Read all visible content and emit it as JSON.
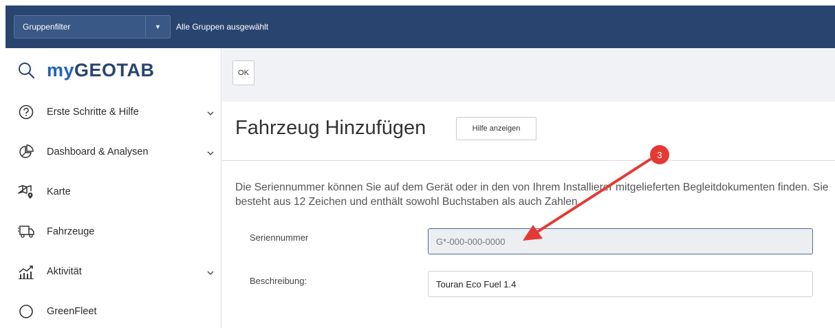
{
  "topbar": {
    "group_filter_label": "Gruppenfilter",
    "group_filter_summary": "Alle Gruppen ausgewählt"
  },
  "sidebar": {
    "logo_prefix": "my",
    "logo_main": "GEOTAB",
    "items": [
      {
        "label": "Erste Schritte & Hilfe",
        "icon": "help-circle-icon",
        "expandable": true
      },
      {
        "label": "Dashboard & Analysen",
        "icon": "pie-chart-icon",
        "expandable": true
      },
      {
        "label": "Karte",
        "icon": "map-icon",
        "expandable": false
      },
      {
        "label": "Fahrzeuge",
        "icon": "truck-icon",
        "expandable": false
      },
      {
        "label": "Aktivität",
        "icon": "activity-chart-icon",
        "expandable": true
      },
      {
        "label": "GreenFleet",
        "icon": "circle-icon",
        "expandable": false
      }
    ]
  },
  "toolbar": {
    "ok_label": "OK"
  },
  "page": {
    "title": "Fahrzeug Hinzufügen",
    "help_label": "Hilfe anzeigen",
    "description": "Die Seriennummer können Sie auf dem Gerät oder in den von Ihrem Installierer mitgelieferten Begleitdokumenten finden. Sie besteht aus 12 Zeichen und enthält sowohl Buchstaben als auch Zahlen."
  },
  "form": {
    "serial_label": "Seriennummer",
    "serial_placeholder": "G*-000-000-0000",
    "serial_value": "",
    "description_label": "Beschreibung:",
    "description_value": "Touran Eco Fuel 1.4"
  },
  "annotation": {
    "badge": "3",
    "color": "#e53935"
  },
  "colors": {
    "topbar": "#2a4470",
    "brand_blue": "#2562b8"
  }
}
